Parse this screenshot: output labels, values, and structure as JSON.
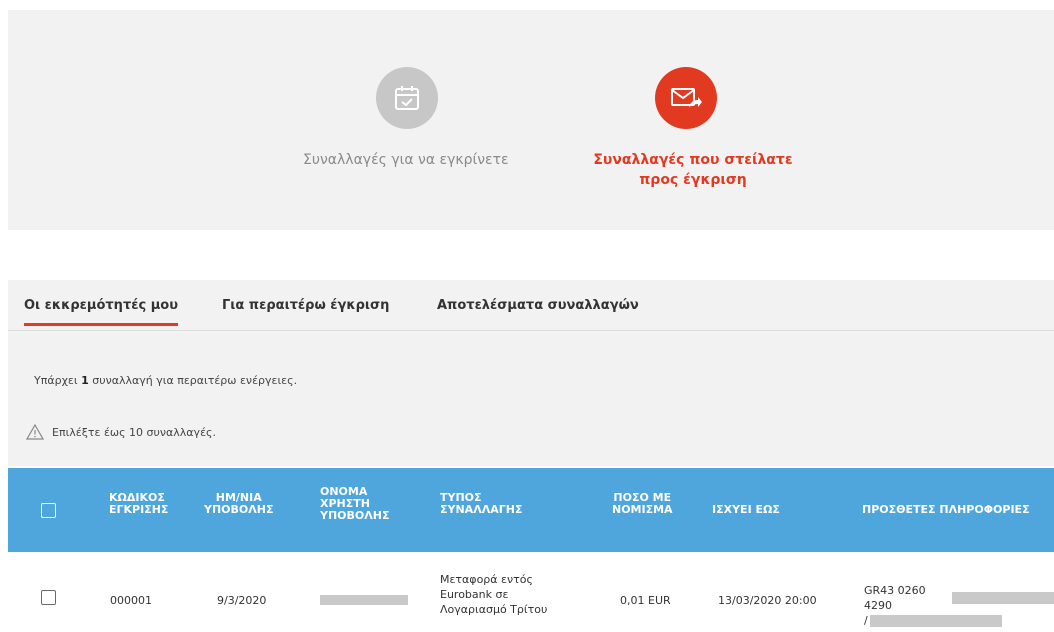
{
  "steps": [
    {
      "label": "Συναλλαγές για να εγκρίνετε",
      "icon": "calendar-check-icon",
      "state": "inactive"
    },
    {
      "label_line1": "Συναλλαγές που στείλατε",
      "label_line2": "προς έγκριση",
      "icon": "mail-forward-icon",
      "state": "active"
    }
  ],
  "tabs": [
    {
      "label": "Οι εκκρεμότητές μου",
      "active": true
    },
    {
      "label": "Για περαιτέρω έγκριση",
      "active": false
    },
    {
      "label": "Αποτελέσματα συναλλαγών",
      "active": false
    }
  ],
  "info": {
    "prefix": "Υπάρχει ",
    "count": "1",
    "suffix": " συναλλαγή για περαιτέρω ενέργειες."
  },
  "warning": {
    "icon": "warning-triangle-icon",
    "text": "Επιλέξτε έως 10 συναλλαγές."
  },
  "table": {
    "headers": {
      "code_1": "ΚΩΔΙΚΟΣ",
      "code_2": "ΕΓΚΡΙΣΗΣ",
      "date_1": "ΗΜ/ΝΙΑ",
      "date_2": "ΥΠΟΒΟΛΗΣ",
      "user_1": "ΟΝΟΜΑ",
      "user_2": "ΧΡΗΣΤΗ",
      "user_3": "ΥΠΟΒΟΛΗΣ",
      "type_1": "ΤΥΠΟΣ",
      "type_2": "ΣΥΝΑΛΛΑΓΗΣ",
      "amount_1": "ΠΟΣΟ ΜΕ",
      "amount_2": "ΝΟΜΙΣΜΑ",
      "valid": "ΙΣΧΥΕΙ ΕΩΣ",
      "extra": "ΠΡΟΣΘΕΤΕΣ ΠΛΗΡΟΦΟΡΙΕΣ"
    },
    "rows": [
      {
        "code": "000001",
        "date": "9/3/2020",
        "type_1": "Μεταφορά εντός",
        "type_2": "Eurobank σε",
        "type_3": "Λογαριασμό Τρίτου",
        "amount": "0,01 EUR",
        "valid_until": "13/03/2020 20:00",
        "extra_1": "GR43 0260 4290",
        "extra_2": "/"
      }
    ]
  },
  "colors": {
    "accent_red": "#e23a21",
    "table_header_blue": "#4ea6dc",
    "inactive_grey": "#c7c7c7"
  }
}
